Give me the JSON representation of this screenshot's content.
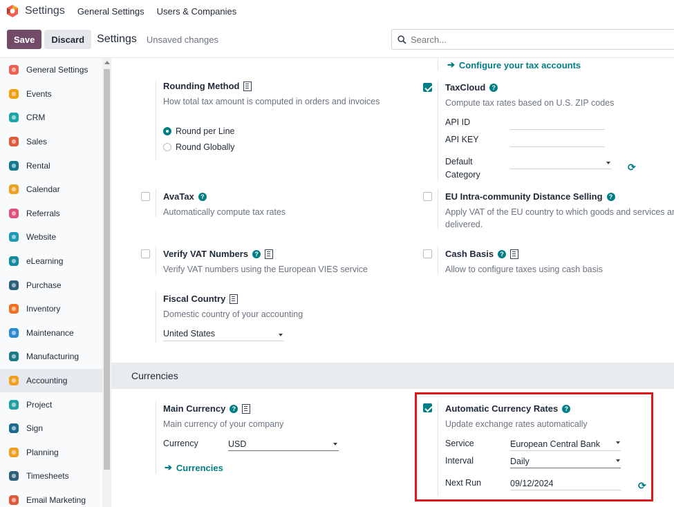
{
  "topbar": {
    "app_title": "Settings",
    "menu": [
      "General Settings",
      "Users & Companies"
    ]
  },
  "control": {
    "save_label": "Save",
    "discard_label": "Discard",
    "title": "Settings",
    "status": "Unsaved changes",
    "search_placeholder": "Search..."
  },
  "sidebar": {
    "items": [
      {
        "label": "General Settings",
        "icon": "settings-app-icon",
        "color": "#f06050"
      },
      {
        "label": "Events",
        "icon": "events-app-icon",
        "color": "#f59e0b"
      },
      {
        "label": "CRM",
        "icon": "crm-app-icon",
        "color": "#1aa6a6"
      },
      {
        "label": "Sales",
        "icon": "sales-app-icon",
        "color": "#e05a3a"
      },
      {
        "label": "Rental",
        "icon": "rental-app-icon",
        "color": "#0f7a8c"
      },
      {
        "label": "Calendar",
        "icon": "calendar-app-icon",
        "color": "#f0a020"
      },
      {
        "label": "Referrals",
        "icon": "referrals-app-icon",
        "color": "#e0507a"
      },
      {
        "label": "Website",
        "icon": "website-app-icon",
        "color": "#1a9bb5"
      },
      {
        "label": "eLearning",
        "icon": "elearning-app-icon",
        "color": "#0e8a9a"
      },
      {
        "label": "Purchase",
        "icon": "purchase-app-icon",
        "color": "#2b5f7a"
      },
      {
        "label": "Inventory",
        "icon": "inventory-app-icon",
        "color": "#f07020"
      },
      {
        "label": "Maintenance",
        "icon": "maintenance-app-icon",
        "color": "#2a8ad4"
      },
      {
        "label": "Manufacturing",
        "icon": "manufacturing-app-icon",
        "color": "#1a7a8a"
      },
      {
        "label": "Accounting",
        "icon": "accounting-app-icon",
        "color": "#f0a020",
        "active": true
      },
      {
        "label": "Project",
        "icon": "project-app-icon",
        "color": "#20a0a0"
      },
      {
        "label": "Sign",
        "icon": "sign-app-icon",
        "color": "#1a6a8a"
      },
      {
        "label": "Planning",
        "icon": "planning-app-icon",
        "color": "#f0a020"
      },
      {
        "label": "Timesheets",
        "icon": "timesheets-app-icon",
        "color": "#2b5f7a"
      },
      {
        "label": "Email Marketing",
        "icon": "email-marketing-app-icon",
        "color": "#e05a3a"
      }
    ]
  },
  "taxes": {
    "configure_link": "Configure your tax accounts",
    "rounding": {
      "title": "Rounding Method",
      "desc": "How total tax amount is computed in orders and invoices",
      "options": [
        "Round per Line",
        "Round Globally"
      ],
      "selected": "Round per Line"
    },
    "taxcloud": {
      "title": "TaxCloud",
      "desc": "Compute tax rates based on U.S. ZIP codes",
      "checked": true,
      "api_id_label": "API ID",
      "api_key_label": "API KEY",
      "default_label": "Default",
      "category_label": "Category"
    },
    "avatax": {
      "title": "AvaTax",
      "desc": "Automatically compute tax rates",
      "checked": false
    },
    "eu": {
      "title": "EU Intra-community Distance Selling",
      "desc1": "Apply VAT of the EU country to which goods and services are",
      "desc2": "delivered.",
      "checked": false
    },
    "vat": {
      "title": "Verify VAT Numbers",
      "desc": "Verify VAT numbers using the European VIES service",
      "checked": false
    },
    "cash": {
      "title": "Cash Basis",
      "desc": "Allow to configure taxes using cash basis",
      "checked": false
    },
    "fiscal": {
      "title": "Fiscal Country",
      "desc": "Domestic country of your accounting",
      "value": "United States"
    }
  },
  "currencies": {
    "section_title": "Currencies",
    "main": {
      "title": "Main Currency",
      "desc": "Main currency of your company",
      "currency_label": "Currency",
      "currency_value": "USD",
      "link": "Currencies"
    },
    "auto": {
      "title": "Automatic Currency Rates",
      "desc": "Update exchange rates automatically",
      "checked": true,
      "service_label": "Service",
      "service_value": "European Central Bank",
      "interval_label": "Interval",
      "interval_value": "Daily",
      "next_run_label": "Next Run",
      "next_run_value": "09/12/2024"
    }
  },
  "colors": {
    "brand": "#714b67",
    "accent": "#017e84",
    "highlight": "#e0161d"
  }
}
